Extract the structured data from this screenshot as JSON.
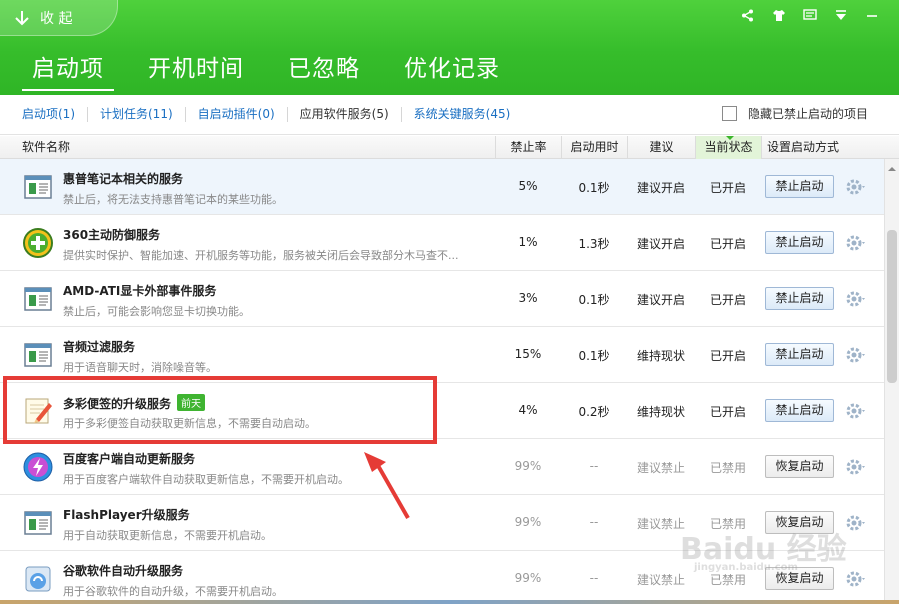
{
  "header": {
    "collapse_label": "收 起",
    "window_controls": [
      "share-icon",
      "skin-icon",
      "feedback-icon",
      "menu-icon",
      "minimize-icon"
    ],
    "tabs": [
      {
        "label": "启动项",
        "active": true
      },
      {
        "label": "开机时间",
        "active": false
      },
      {
        "label": "已忽略",
        "active": false
      },
      {
        "label": "优化记录",
        "active": false
      }
    ]
  },
  "filters": {
    "items": [
      {
        "label": "启动项(1)"
      },
      {
        "label": "计划任务(11)"
      },
      {
        "label": "自启动插件(0)"
      },
      {
        "label": "应用软件服务(5)"
      },
      {
        "label": "系统关键服务(45)"
      }
    ],
    "hide_disabled_label": "隐藏已禁止启动的项目"
  },
  "columns": {
    "name": "软件名称",
    "rate": "禁止率",
    "time": "启动用时",
    "advice": "建议",
    "state": "当前状态",
    "setting": "设置启动方式"
  },
  "rows": [
    {
      "title": "惠普笔记本相关的服务",
      "desc": "禁止后，将无法支持惠普笔记本的某些功能。",
      "rate": "5%",
      "time": "0.1秒",
      "advice": "建议开启",
      "state": "已开启",
      "action": "禁止启动",
      "icon": "window-app-icon"
    },
    {
      "title": "360主动防御服务",
      "desc": "提供实时保护、智能加速、开机服务等功能，服务被关闭后会导致部分木马查不...",
      "rate": "1%",
      "time": "1.3秒",
      "advice": "建议开启",
      "state": "已开启",
      "action": "禁止启动",
      "icon": "360-shield-icon"
    },
    {
      "title": "AMD-ATI显卡外部事件服务",
      "desc": "禁止后，可能会影响您显卡切换功能。",
      "rate": "3%",
      "time": "0.1秒",
      "advice": "建议开启",
      "state": "已开启",
      "action": "禁止启动",
      "icon": "window-app-icon"
    },
    {
      "title": "音频过滤服务",
      "desc": "用于语音聊天时，消除噪音等。",
      "rate": "15%",
      "time": "0.1秒",
      "advice": "维持现状",
      "state": "已开启",
      "action": "禁止启动",
      "icon": "window-app-icon"
    },
    {
      "title": "多彩便签的升级服务",
      "badge": "前天",
      "desc": "用于多彩便签自动获取更新信息，不需要自动启动。",
      "rate": "4%",
      "time": "0.2秒",
      "advice": "维持现状",
      "state": "已开启",
      "action": "禁止启动",
      "icon": "sticky-note-icon"
    },
    {
      "title": "百度客户端自动更新服务",
      "desc": "用于百度客户端软件自动获取更新信息，不需要开机启动。",
      "rate": "99%",
      "time": "--",
      "advice": "建议禁止",
      "state": "已禁用",
      "action": "恢复启动",
      "icon": "baidu-client-icon"
    },
    {
      "title": "FlashPlayer升级服务",
      "desc": "用于自动获取更新信息，不需要开机启动。",
      "rate": "99%",
      "time": "--",
      "advice": "建议禁止",
      "state": "已禁用",
      "action": "恢复启动",
      "icon": "window-app-icon"
    },
    {
      "title": "谷歌软件自动升级服务",
      "desc": "用于谷歌软件的自动升级，不需要开机启动。",
      "rate": "99%",
      "time": "--",
      "advice": "建议禁止",
      "state": "已禁用",
      "action": "恢复启动",
      "icon": "google-update-icon"
    }
  ],
  "colors": {
    "header_green": "#36bd2b",
    "link_blue": "#1a6fc2",
    "highlight_red": "#e53b36"
  },
  "watermark": {
    "logo": "Baidu 经验",
    "sub": "jingyan.baidu.com"
  }
}
